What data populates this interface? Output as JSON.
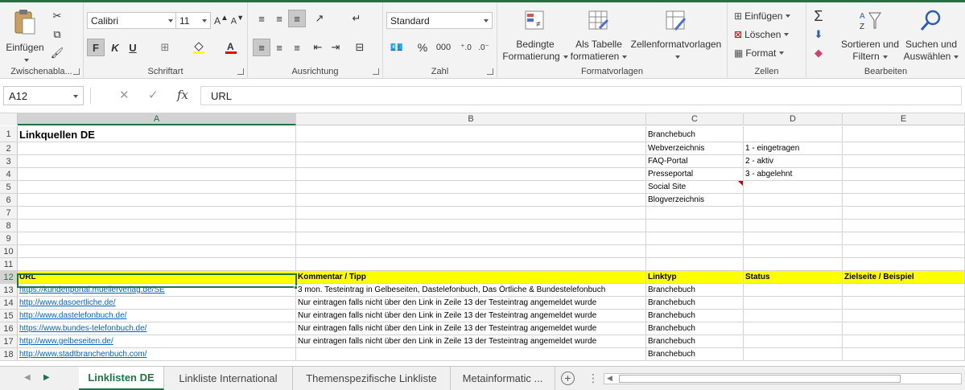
{
  "ribbon": {
    "clipboard": {
      "paste": "Einfügen",
      "label": "Zwischenabla..."
    },
    "font": {
      "name": "Calibri",
      "size": "11",
      "bold": "F",
      "italic": "K",
      "underline": "U",
      "label": "Schriftart"
    },
    "alignment": {
      "label": "Ausrichtung"
    },
    "number": {
      "format": "Standard",
      "percent": "%",
      "thousands": "000",
      "label": "Zahl"
    },
    "styles": {
      "cond_line1": "Bedingte",
      "cond_line2": "Formatierung",
      "table_line1": "Als Tabelle",
      "table_line2": "formatieren",
      "cellstyles": "Zellenformatvorlagen",
      "label": "Formatvorlagen"
    },
    "cells": {
      "insert": "Einfügen",
      "delete": "Löschen",
      "format": "Format",
      "label": "Zellen"
    },
    "editing": {
      "sort_line1": "Sortieren und",
      "sort_line2": "Filtern",
      "find_line1": "Suchen und",
      "find_line2": "Auswählen",
      "label": "Bearbeiten"
    }
  },
  "formula_bar": {
    "name_box": "A12",
    "fx": "fx",
    "value": "URL"
  },
  "columns": [
    "A",
    "B",
    "C",
    "D",
    "E"
  ],
  "rows": [
    {
      "n": "1",
      "a": "Linkquellen DE",
      "b": "",
      "c": "Branchebuch",
      "d": "",
      "e": ""
    },
    {
      "n": "2",
      "a": "",
      "b": "",
      "c": "Webverzeichnis",
      "d": "1 - eingetragen",
      "e": ""
    },
    {
      "n": "3",
      "a": "",
      "b": "",
      "c": "FAQ-Portal",
      "d": "2 - aktiv",
      "e": ""
    },
    {
      "n": "4",
      "a": "",
      "b": "",
      "c": "Presseportal",
      "d": "3 - abgelehnt",
      "e": ""
    },
    {
      "n": "5",
      "a": "",
      "b": "",
      "c": "Social Site",
      "d": "",
      "e": ""
    },
    {
      "n": "6",
      "a": "",
      "b": "",
      "c": "Blogverzeichnis",
      "d": "",
      "e": ""
    },
    {
      "n": "7",
      "a": "",
      "b": "",
      "c": "",
      "d": "",
      "e": ""
    },
    {
      "n": "8",
      "a": "",
      "b": "",
      "c": "",
      "d": "",
      "e": ""
    },
    {
      "n": "9",
      "a": "",
      "b": "",
      "c": "",
      "d": "",
      "e": ""
    },
    {
      "n": "10",
      "a": "",
      "b": "",
      "c": "",
      "d": "",
      "e": ""
    },
    {
      "n": "11",
      "a": "",
      "b": "",
      "c": "",
      "d": "",
      "e": ""
    },
    {
      "n": "12",
      "a": "URL",
      "b": "Kommentar / Tipp",
      "c": "Linktyp",
      "d": "Status",
      "e": "Zielseite / Beispiel"
    },
    {
      "n": "13",
      "a": "https://kundenportal.muellerverlag.de/SE",
      "b": "3 mon. Testeintrag in Gelbeseiten, Dastelefonbuch, Das Örtliche & Bundestelefonbuch",
      "c": "Branchebuch",
      "d": "",
      "e": ""
    },
    {
      "n": "14",
      "a": "http://www.dasoertliche.de/",
      "b": "Nur eintragen falls nicht über den Link in Zeile 13 der Testeintrag angemeldet wurde",
      "c": "Branchebuch",
      "d": "",
      "e": ""
    },
    {
      "n": "15",
      "a": "http://www.dastelefonbuch.de/",
      "b": "Nur eintragen falls nicht über den Link in Zeile 13 der Testeintrag angemeldet wurde",
      "c": "Branchebuch",
      "d": "",
      "e": ""
    },
    {
      "n": "16",
      "a": "https://www.bundes-telefonbuch.de/",
      "b": "Nur eintragen falls nicht über den Link in Zeile 13 der Testeintrag angemeldet wurde",
      "c": "Branchebuch",
      "d": "",
      "e": ""
    },
    {
      "n": "17",
      "a": "http://www.gelbeseiten.de/",
      "b": "Nur eintragen falls nicht über den Link in Zeile 13 der Testeintrag angemeldet wurde",
      "c": "Branchebuch",
      "d": "",
      "e": ""
    },
    {
      "n": "18",
      "a": "http://www.stadtbranchenbuch.com/",
      "b": "",
      "c": "Branchebuch",
      "d": "",
      "e": ""
    }
  ],
  "sheet_tabs": [
    "Linklisten DE",
    "Linkliste International",
    "Themenspezifische Linkliste",
    "Metainformatic ..."
  ],
  "colors": {
    "accent": "#217346",
    "highlight": "#ffff00",
    "link": "#0563c1"
  }
}
